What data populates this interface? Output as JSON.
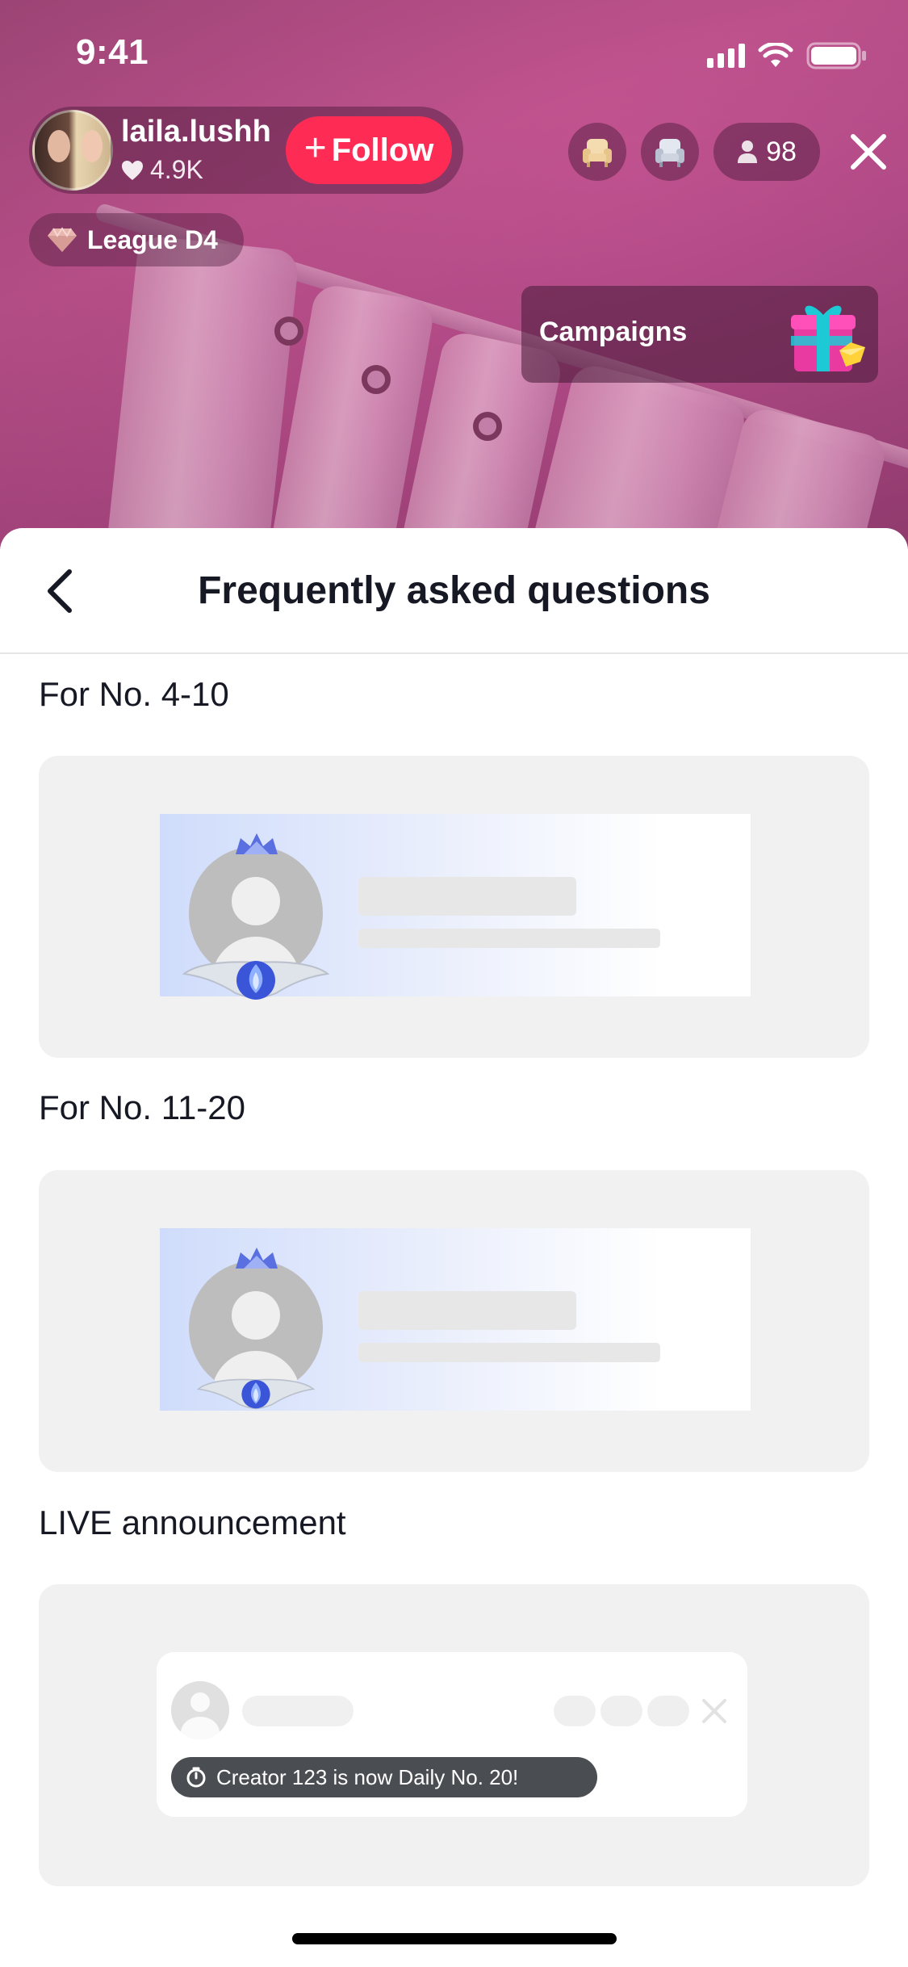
{
  "status_bar": {
    "time": "9:41"
  },
  "host": {
    "username": "laila.lushh",
    "likes": "4.9K",
    "follow_label": "Follow",
    "league": "League D4"
  },
  "viewers": {
    "count": "98"
  },
  "campaigns": {
    "label": "Campaigns"
  },
  "sheet": {
    "title": "Frequently asked questions",
    "sections": [
      {
        "label": "For No. 4-10"
      },
      {
        "label": "For No. 11-20"
      },
      {
        "label": "LIVE announcement"
      }
    ],
    "announcement_toast": "Creator 123 is now Daily No. 20!"
  },
  "colors": {
    "follow": "#fe2c55",
    "sheet_bg": "#ffffff",
    "preview_bg": "#f1f1f1",
    "toast_bg": "#4a4d52"
  },
  "icons": [
    "signal-icon",
    "wifi-icon",
    "battery-icon",
    "heart-icon",
    "plus-icon",
    "seat-icon",
    "person-icon",
    "close-icon",
    "diamond-icon",
    "gift-icon",
    "back-chevron-icon",
    "crown-icon",
    "wings-icon",
    "timer-icon",
    "x-icon"
  ]
}
